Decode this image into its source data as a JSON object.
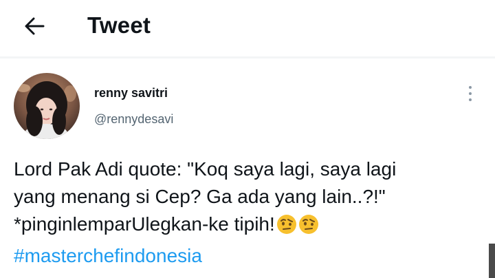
{
  "header": {
    "title": "Tweet",
    "back_icon": "arrow-left-icon"
  },
  "author": {
    "display_name": "renny savitri",
    "handle": "@rennydesavi",
    "avatar": "avatar-photo"
  },
  "more_icon": "vertical-ellipsis-icon",
  "tweet": {
    "line1": "Lord Pak Adi quote: \"Koq saya lagi, saya lagi",
    "line2": "yang menang si Cep? Ga ada yang lain..?!\"",
    "line3": "*pinginlemparUlegkan-ke tipih!",
    "emojis": [
      "face-with-raised-eyebrow",
      "face-with-raised-eyebrow"
    ],
    "hashtag": "#masterchefindonesia"
  },
  "colors": {
    "text": "#0f1419",
    "secondary": "#536471",
    "link": "#1d9bf0"
  }
}
